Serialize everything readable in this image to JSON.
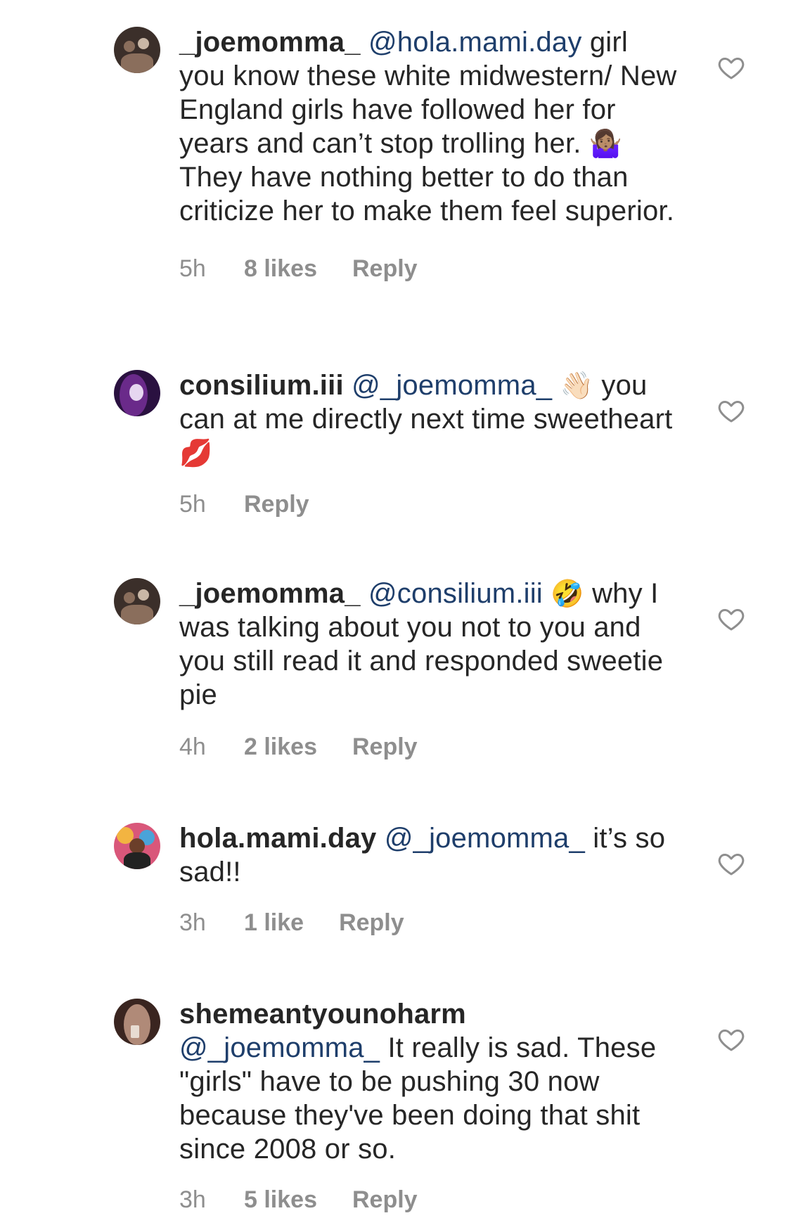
{
  "comments": [
    {
      "username": "_joemomma_",
      "mention": "@hola.mami.day",
      "text_before_emoji": " girl you know these white midwestern/ New England girls have followed her for years and can’t stop trolling her. ",
      "emoji": "🤷🏽‍♀️",
      "text_after_emoji": " They have nothing better to do than criticize her to make them feel superior.",
      "time": "5h",
      "likes": "8 likes",
      "reply": "Reply",
      "avatar_colors": [
        "#3b2f2a",
        "#8a6e5c",
        "#c9b7a6"
      ]
    },
    {
      "username": "consilium.iii",
      "mention": "@_joemomma_",
      "text_before_emoji": " ",
      "emoji": "👋🏻",
      "text_after_emoji": " you can at me directly next time sweetheart ",
      "emoji_end": "💋",
      "time": "5h",
      "likes": "",
      "reply": "Reply",
      "avatar_colors": [
        "#2a1140",
        "#6a2a8a",
        "#e6d6f0"
      ]
    },
    {
      "username": "_joemomma_",
      "mention": "@consilium.iii",
      "text_before_emoji": " ",
      "emoji": "🤣",
      "text_after_emoji": " why I was talking about you not to you and you still read it and responded sweetie pie",
      "time": "4h",
      "likes": "2 likes",
      "reply": "Reply",
      "avatar_colors": [
        "#3b2f2a",
        "#8a6e5c",
        "#c9b7a6"
      ]
    },
    {
      "username": "hola.mami.day",
      "mention": "@_joemomma_",
      "text_before_emoji": " it’s so sad!!",
      "emoji": "",
      "text_after_emoji": "",
      "time": "3h",
      "likes": "1 like",
      "reply": "Reply",
      "avatar_colors": [
        "#d9577a",
        "#f2b441",
        "#4aa3d9"
      ]
    },
    {
      "username": "shemeantyounoharm",
      "mention": "@_joemomma_",
      "text_before_emoji": " It really is sad. These \"girls\" have to be pushing 30 now because they've been doing that shit since 2008 or so.",
      "emoji": "",
      "text_after_emoji": "",
      "time": "3h",
      "likes": "5 likes",
      "reply": "Reply",
      "avatar_colors": [
        "#3a2520",
        "#b08a78",
        "#e8dcd2"
      ]
    }
  ],
  "colors": {
    "text": "#262626",
    "mention": "#1e3e6b",
    "meta": "#8e8e8e",
    "heart": "#8e8e8e"
  },
  "icons": {
    "like": "heart-outline-icon"
  }
}
